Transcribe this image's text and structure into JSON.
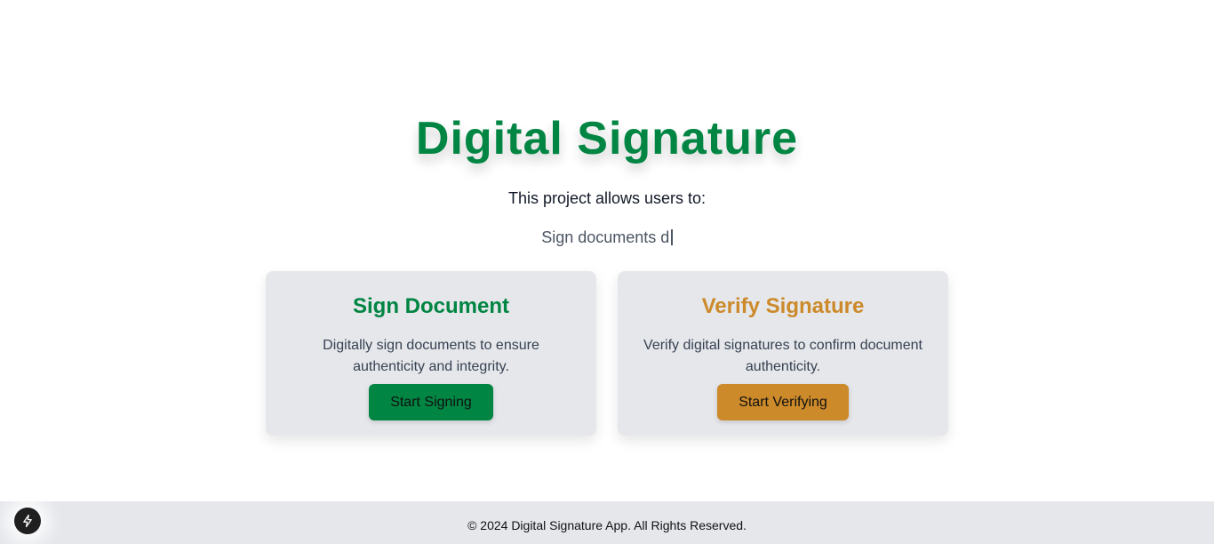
{
  "colors": {
    "green": "#008542",
    "amber": "#cc8a2a",
    "card_bg": "#e5e7eb",
    "footer_bg": "#e5e7eb"
  },
  "hero": {
    "title": "Digital Signature",
    "intro": "This project allows users to:",
    "typing_text": "Sign documents d"
  },
  "cards": [
    {
      "title": "Sign Document",
      "description": "Digitally sign documents to ensure authenticity and integrity.",
      "button_label": "Start Signing"
    },
    {
      "title": "Verify Signature",
      "description": "Verify digital signatures to confirm document authenticity.",
      "button_label": "Start Verifying"
    }
  ],
  "footer": {
    "text": "© 2024 Digital Signature App. All Rights Reserved."
  },
  "dev_badge": {
    "icon": "lightning-icon"
  }
}
